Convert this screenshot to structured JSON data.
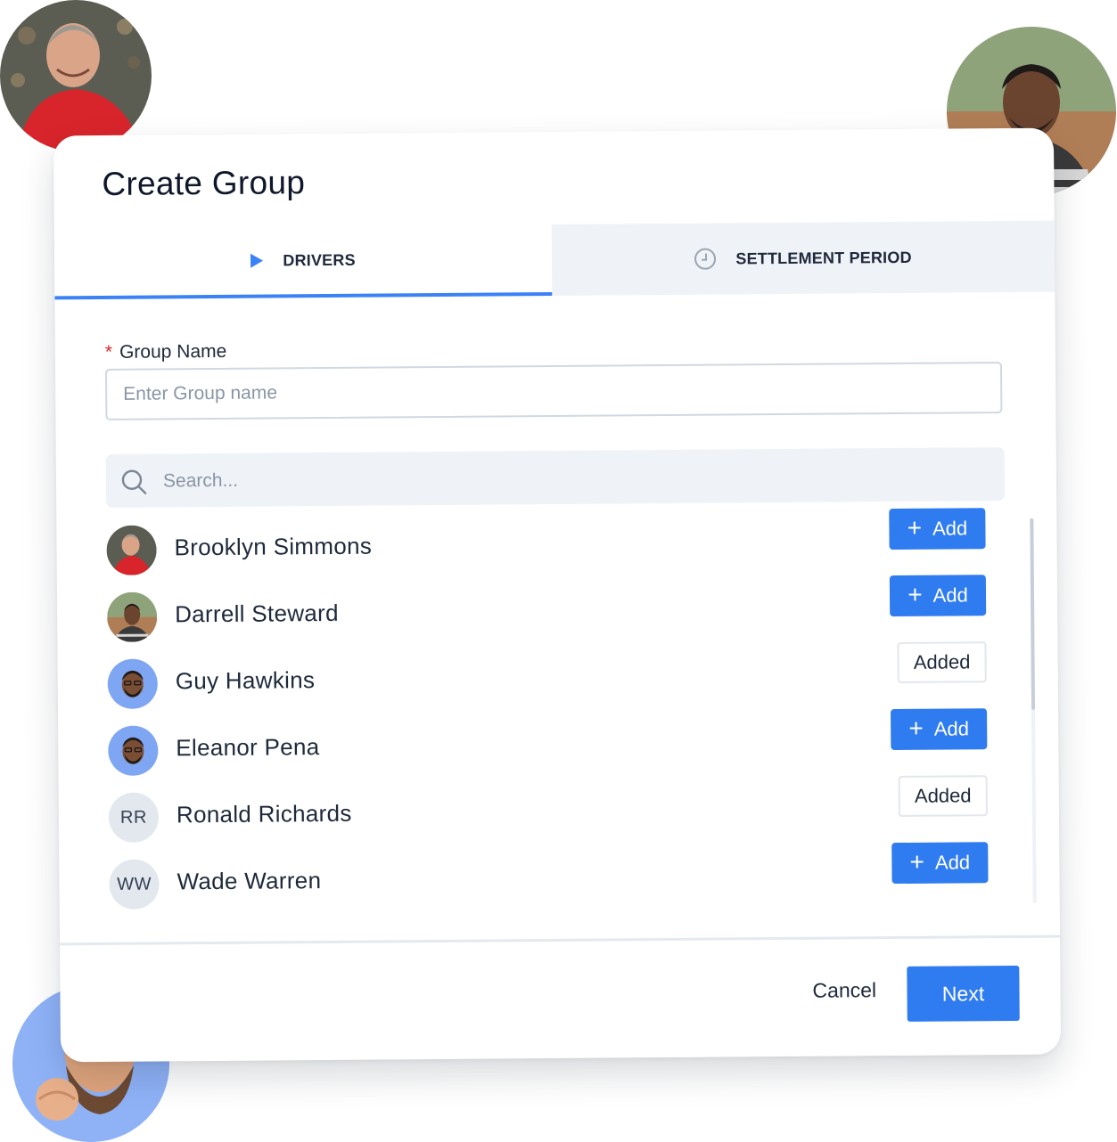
{
  "dialog": {
    "title": "Create Group"
  },
  "tabs": [
    {
      "label": "DRIVERS",
      "icon": "play-icon",
      "active": true
    },
    {
      "label": "SETTLEMENT PERIOD",
      "icon": "clock-icon",
      "active": false
    }
  ],
  "form": {
    "group_name_label": "Group Name",
    "required_marker": "*",
    "group_name_value": "",
    "group_name_placeholder": "Enter Group name"
  },
  "search": {
    "value": "",
    "placeholder": "Search...",
    "icon": "search-icon"
  },
  "drivers": [
    {
      "name": "Brooklyn Simmons",
      "avatar": "photo",
      "action": "Add",
      "added": false
    },
    {
      "name": "Darrell Steward",
      "avatar": "photo",
      "action": "Add",
      "added": false
    },
    {
      "name": "Guy Hawkins",
      "avatar": "memoji",
      "action": "Added",
      "added": true
    },
    {
      "name": "Eleanor Pena",
      "avatar": "memoji",
      "action": "Add",
      "added": false
    },
    {
      "name": "Ronald Richards",
      "avatar": "initials",
      "initials": "RR",
      "action": "Added",
      "added": true
    },
    {
      "name": "Wade Warren",
      "avatar": "initials",
      "initials": "WW",
      "action": "Add",
      "added": false
    }
  ],
  "add_symbol": "+",
  "footer": {
    "cancel_label": "Cancel",
    "next_label": "Next"
  },
  "colors": {
    "primary": "#2f7cf0",
    "tab_inactive_bg": "#eff2f7",
    "avatar_memoji_bg": "#7ea6f2"
  }
}
